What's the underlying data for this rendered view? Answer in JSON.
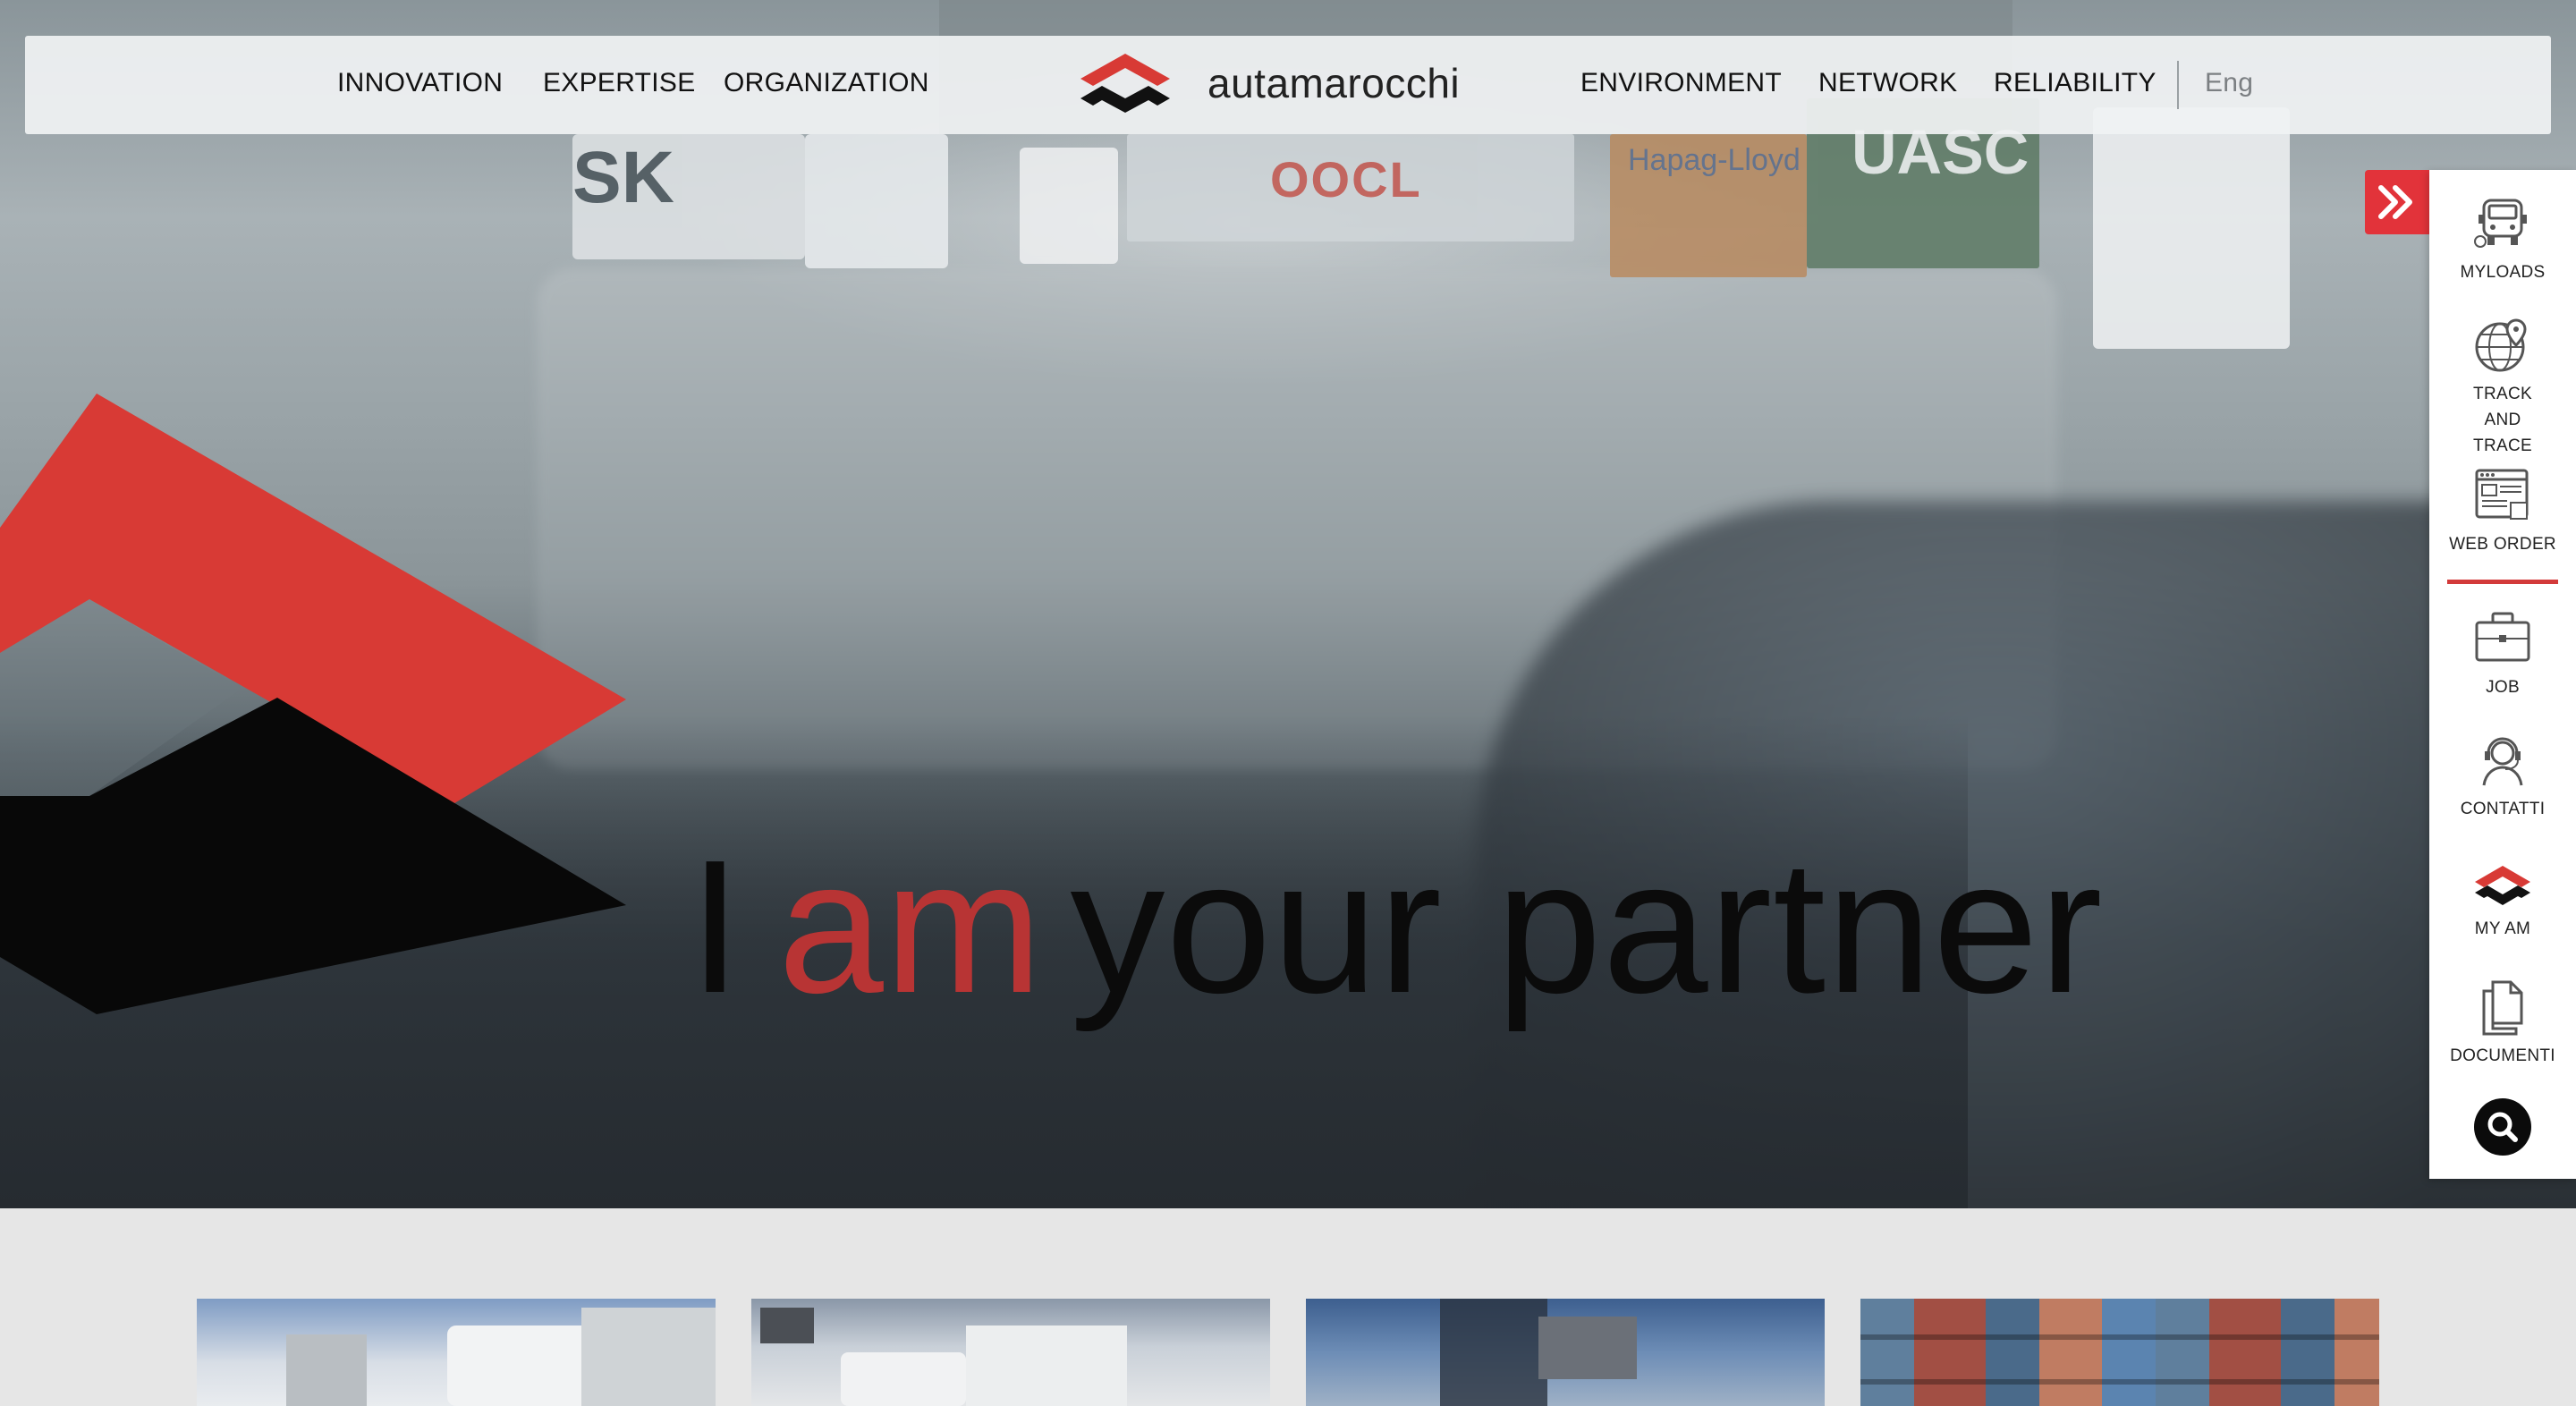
{
  "nav": {
    "left_links": [
      "INNOVATION",
      "EXPERTISE",
      "ORGANIZATION"
    ],
    "brand_name": "autamarocchi",
    "right_links": [
      "ENVIRONMENT",
      "NETWORK",
      "RELIABILITY"
    ],
    "language": "Eng"
  },
  "hero": {
    "headline_pre": "I",
    "headline_accent": "am",
    "headline_post": "your partner",
    "scene_text": {
      "left_trailer": "SK",
      "center_trailer": "OOCL",
      "right_container": "UASC",
      "orange_container": "Hapag-Lloyd"
    }
  },
  "dock": {
    "items": [
      {
        "label": "MYLOADS",
        "icon": "truck-icon"
      },
      {
        "label": "TRACK AND TRACE",
        "icon": "globe-pin-icon"
      },
      {
        "label": "WEB ORDER",
        "icon": "web-order-icon"
      },
      {
        "label": "JOB",
        "icon": "briefcase-icon"
      },
      {
        "label": "CONTATTI",
        "icon": "headset-icon"
      },
      {
        "label": "MY AM",
        "icon": "am-logo-icon"
      },
      {
        "label": "DOCUMENTI",
        "icon": "documents-icon"
      }
    ]
  },
  "colors": {
    "brand_red": "#e2333a",
    "headline_accent": "#b83434",
    "nav_bg": "#f0f2f3"
  }
}
